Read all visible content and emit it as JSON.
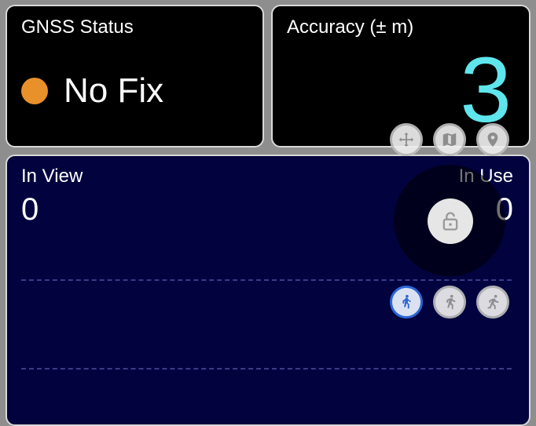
{
  "gnss": {
    "title": "GNSS Status",
    "status": "No Fix",
    "status_color": "#e8902a"
  },
  "accuracy": {
    "title": "Accuracy (± m)",
    "value": "3",
    "value_color": "#5fe6ec"
  },
  "satellites": {
    "in_view_label": "In View",
    "in_view_value": "0",
    "in_use_label": "In Use",
    "in_use_value": "0",
    "background": "#02023f"
  },
  "controls": {
    "top_row": [
      "move-icon",
      "map-icon",
      "location-pin-icon"
    ],
    "activity_row": [
      "walking-icon",
      "running-icon",
      "sprinting-icon"
    ],
    "active_activity": "walking-icon",
    "lock": "lock-open-icon",
    "active_color": "#2f6fe0"
  }
}
